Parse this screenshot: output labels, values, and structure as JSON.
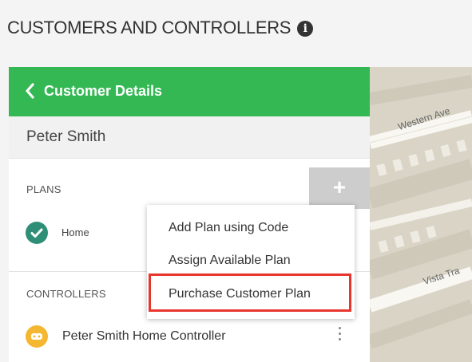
{
  "header": {
    "title": "CUSTOMERS AND CONTROLLERS",
    "info_icon": "info-circle-icon"
  },
  "panel": {
    "back_label": "Customer Details",
    "customer_name": "Peter Smith",
    "plans": {
      "label": "PLANS",
      "add_icon": "plus-icon",
      "items": [
        {
          "name": "Home",
          "icon": "check-circle-icon"
        }
      ]
    },
    "controllers": {
      "label": "CONTROLLERS",
      "items": [
        {
          "name": "Peter Smith Home Controller",
          "icon": "controller-icon"
        }
      ]
    }
  },
  "plan_menu": {
    "items": [
      {
        "label": "Add Plan using Code"
      },
      {
        "label": "Assign Available Plan"
      },
      {
        "label": "Purchase Customer Plan",
        "highlighted": true
      }
    ]
  },
  "map": {
    "streets": [
      "Western Ave",
      "Vista Tra"
    ]
  },
  "colors": {
    "header_green": "#34b853",
    "plan_check": "#2f8f76",
    "controller_badge": "#f5b731",
    "highlight_border": "#e8352e"
  }
}
